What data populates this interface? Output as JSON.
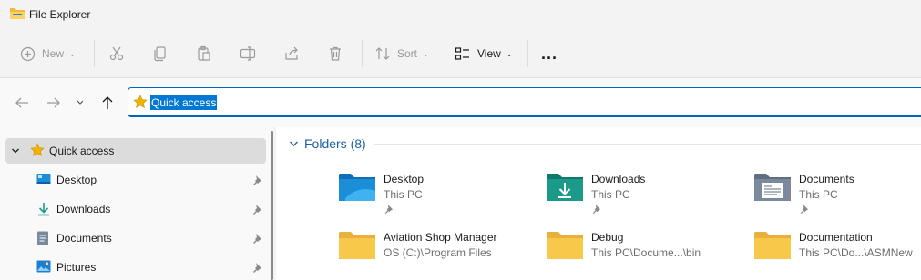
{
  "window": {
    "title": "File Explorer"
  },
  "toolbar": {
    "new_label": "New",
    "sort_label": "Sort",
    "view_label": "View",
    "more_label": "..."
  },
  "address": {
    "path_text": "Quick access"
  },
  "sidebar": {
    "items": [
      {
        "label": "Quick access",
        "icon": "star-icon"
      },
      {
        "label": "Desktop",
        "icon": "desktop-icon"
      },
      {
        "label": "Downloads",
        "icon": "download-icon"
      },
      {
        "label": "Documents",
        "icon": "documents-icon"
      },
      {
        "label": "Pictures",
        "icon": "pictures-icon"
      }
    ]
  },
  "content": {
    "section_title": "Folders (8)",
    "folders": [
      {
        "name": "Desktop",
        "location": "This PC",
        "pinned": true
      },
      {
        "name": "Downloads",
        "location": "This PC",
        "pinned": true
      },
      {
        "name": "Documents",
        "location": "This PC",
        "pinned": true
      },
      {
        "name": "Aviation Shop Manager",
        "location": "OS (C:)\\Program Files",
        "pinned": false
      },
      {
        "name": "Debug",
        "location": "This PC\\Docume...\\bin",
        "pinned": false
      },
      {
        "name": "Documentation",
        "location": "This PC\\Do...\\ASMNew",
        "pinned": false
      }
    ]
  },
  "colors": {
    "accent": "#0067c0",
    "selection": "#0078d4",
    "folder_yellow": "#f8c84a",
    "desktop_blue": "#1a8fd8",
    "downloads_teal": "#1b9a8a",
    "documents_gray": "#7a8a9c"
  }
}
